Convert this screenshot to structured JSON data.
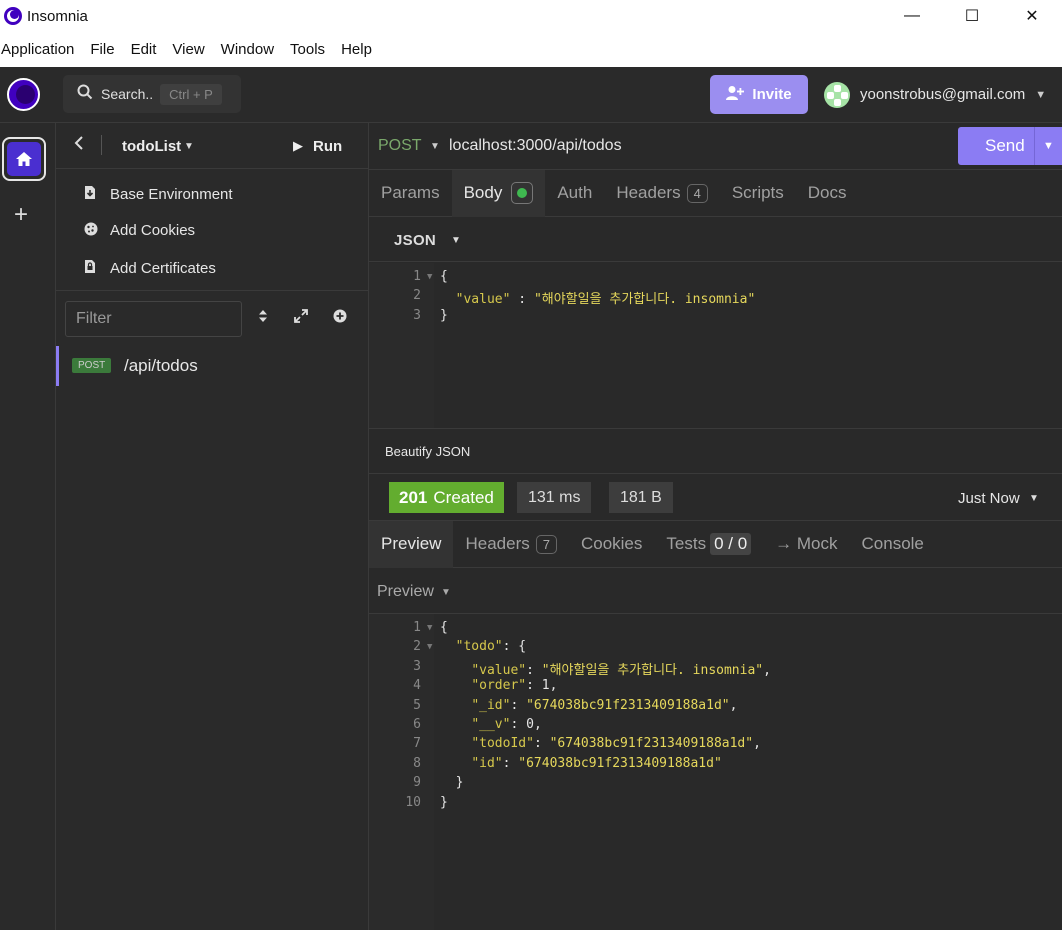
{
  "window": {
    "title": "Insomnia",
    "controls": [
      "—",
      "☐",
      "✕"
    ]
  },
  "menu": [
    "Application",
    "File",
    "Edit",
    "View",
    "Window",
    "Tools",
    "Help"
  ],
  "topbar": {
    "search_label": "Search..",
    "search_shortcut": "Ctrl + P",
    "invite_label": "Invite",
    "user_email": "yoonstrobus@gmail.com"
  },
  "sidebar": {
    "collection_name": "todoList",
    "run_label": "Run",
    "items": [
      {
        "icon": "download-icon",
        "label": "Base Environment"
      },
      {
        "icon": "cookie-icon",
        "label": "Add Cookies"
      },
      {
        "icon": "certificate-icon",
        "label": "Add Certificates"
      }
    ],
    "filter_placeholder": "Filter",
    "requests": [
      {
        "method": "POST",
        "path": "/api/todos"
      }
    ]
  },
  "request": {
    "method": "POST",
    "url": "localhost:3000/api/todos",
    "send_label": "Send",
    "tabs": {
      "params": "Params",
      "body": "Body",
      "auth": "Auth",
      "headers": "Headers",
      "headers_count": "4",
      "scripts": "Scripts",
      "docs": "Docs"
    },
    "body_type": "JSON",
    "body_lines": [
      {
        "n": "1",
        "fold": true,
        "code": "{"
      },
      {
        "n": "2",
        "fold": false,
        "key": "\"value\"",
        "sep": " : ",
        "str": "\"해야할일을 추가합니다. insomnia\""
      },
      {
        "n": "3",
        "fold": false,
        "code": "}"
      }
    ],
    "beautify_label": "Beautify JSON"
  },
  "response": {
    "status_code": "201",
    "status_text": "Created",
    "time": "131 ms",
    "size": "181 B",
    "when": "Just Now",
    "tabs": {
      "preview": "Preview",
      "headers": "Headers",
      "headers_count": "7",
      "cookies": "Cookies",
      "tests": "Tests",
      "tests_result": "0 / 0",
      "mock": "→ Mock",
      "console": "Console"
    },
    "preview_mode": "Preview",
    "body_lines": [
      {
        "n": "1",
        "fold": true,
        "indent": "",
        "text": "{"
      },
      {
        "n": "2",
        "fold": true,
        "indent": "  ",
        "key": "\"todo\"",
        "rest": ": {"
      },
      {
        "n": "3",
        "fold": false,
        "indent": "    ",
        "key": "\"value\"",
        "sep": ": ",
        "str": "\"해야할일을 추가합니다. insomnia\"",
        "tail": ","
      },
      {
        "n": "4",
        "fold": false,
        "indent": "    ",
        "key": "\"order\"",
        "sep": ": ",
        "num": "1",
        "tail": ","
      },
      {
        "n": "5",
        "fold": false,
        "indent": "    ",
        "key": "\"_id\"",
        "sep": ": ",
        "str": "\"674038bc91f2313409188a1d\"",
        "tail": ","
      },
      {
        "n": "6",
        "fold": false,
        "indent": "    ",
        "key": "\"__v\"",
        "sep": ": ",
        "num": "0",
        "tail": ","
      },
      {
        "n": "7",
        "fold": false,
        "indent": "    ",
        "key": "\"todoId\"",
        "sep": ": ",
        "str": "\"674038bc91f2313409188a1d\"",
        "tail": ","
      },
      {
        "n": "8",
        "fold": false,
        "indent": "    ",
        "key": "\"id\"",
        "sep": ": ",
        "str": "\"674038bc91f2313409188a1d\"",
        "tail": ""
      },
      {
        "n": "9",
        "fold": false,
        "indent": "  ",
        "text": "}"
      },
      {
        "n": "10",
        "fold": false,
        "indent": "",
        "text": "}"
      }
    ]
  },
  "colors": {
    "accent": "#8b7cf3",
    "status_ok": "#63ad2f",
    "post_method": "#7aa86b",
    "json_string": "#e6d85c"
  }
}
